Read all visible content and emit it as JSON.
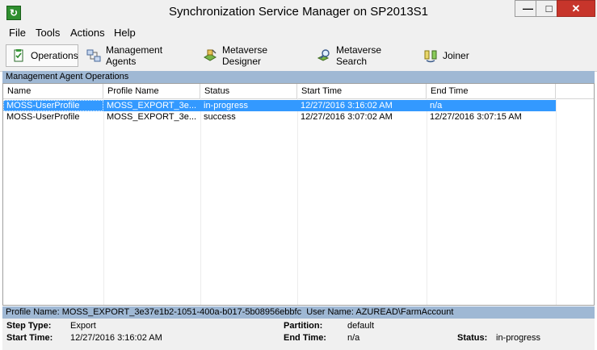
{
  "window": {
    "title": "Synchronization Service Manager on SP2013S1",
    "controls": {
      "minimize": "—",
      "maximize": "□",
      "close": "✕"
    }
  },
  "menu": [
    "File",
    "Tools",
    "Actions",
    "Help"
  ],
  "toolbar": [
    {
      "label": "Operations",
      "icon": "operations-icon",
      "active": true
    },
    {
      "label": "Management Agents",
      "icon": "management-agents-icon"
    },
    {
      "label": "Metaverse Designer",
      "icon": "metaverse-designer-icon"
    },
    {
      "label": "Metaverse Search",
      "icon": "metaverse-search-icon"
    },
    {
      "label": "Joiner",
      "icon": "joiner-icon"
    }
  ],
  "operations": {
    "header": "Management Agent Operations",
    "columns": [
      "Name",
      "Profile Name",
      "Status",
      "Start Time",
      "End Time"
    ],
    "rows": [
      [
        "MOSS-UserProfile",
        "MOSS_EXPORT_3e...",
        "in-progress",
        "12/27/2016 3:16:02 AM",
        "n/a"
      ],
      [
        "MOSS-UserProfile",
        "MOSS_EXPORT_3e...",
        "success",
        "12/27/2016 3:07:02 AM",
        "12/27/2016 3:07:15 AM"
      ]
    ],
    "selected_row": 0
  },
  "details": {
    "header_profile_label": "Profile Name:",
    "header_profile_value": "MOSS_EXPORT_3e37e1b2-1051-400a-b017-5b08956ebbfc",
    "header_user_label": "User Name:",
    "header_user_value": "AZUREAD\\FarmAccount",
    "step_type_label": "Step Type:",
    "step_type_value": "Export",
    "start_time_label": "Start Time:",
    "start_time_value": "12/27/2016 3:16:02 AM",
    "partition_label": "Partition:",
    "partition_value": "default",
    "end_time_label": "End Time:",
    "end_time_value": "n/a",
    "status_label": "Status:",
    "status_value": "in-progress"
  }
}
